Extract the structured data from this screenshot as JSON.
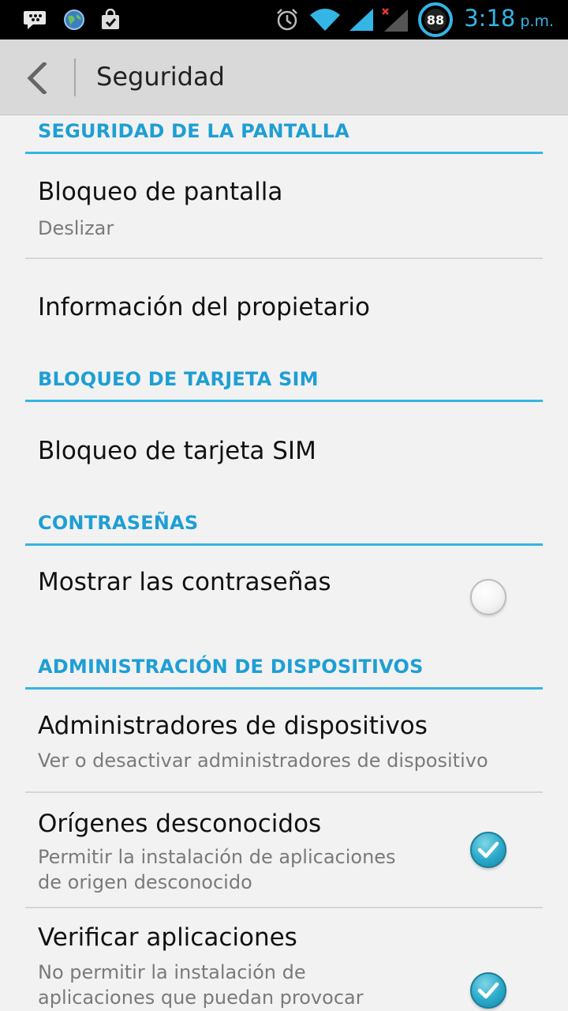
{
  "status_bar": {
    "time": "3:18",
    "ampm": "p.m.",
    "battery_level": "88",
    "icons": [
      "bbm-icon",
      "globe-icon",
      "shopping-bag-icon",
      "alarm-icon",
      "wifi-icon",
      "signal-icon",
      "signal-no-sim-icon",
      "battery-icon"
    ]
  },
  "action_bar": {
    "title": "Seguridad",
    "back_icon": "chevron-left-icon"
  },
  "sections": [
    {
      "header": "SEGURIDAD DE LA PANTALLA",
      "items": [
        {
          "title": "Bloqueo de pantalla",
          "summary": "Deslizar"
        },
        {
          "title": "Información del propietario"
        }
      ]
    },
    {
      "header": "BLOQUEO DE TARJETA SIM",
      "items": [
        {
          "title": "Bloqueo de tarjeta SIM"
        }
      ]
    },
    {
      "header": "CONTRASEÑAS",
      "items": [
        {
          "title": "Mostrar las contraseñas",
          "checked": false
        }
      ]
    },
    {
      "header": "ADMINISTRACIÓN DE DISPOSITIVOS",
      "items": [
        {
          "title": "Administradores de dispositivos",
          "summary": "Ver o desactivar administradores de dispositivo"
        },
        {
          "title": "Orígenes desconocidos",
          "summary_lines": [
            "Permitir la instalación de aplicaciones",
            "de origen desconocido"
          ],
          "checked": true
        },
        {
          "title": "Verificar aplicaciones",
          "summary_lines": [
            "No permitir la instalación de",
            "aplicaciones que puedan provocar"
          ],
          "checked": true
        }
      ]
    }
  ],
  "colors": {
    "accent": "#33b5e5",
    "section_text": "#1e9fd4",
    "action_bar": "#d9d9d9",
    "background": "#f2f2f2",
    "checkbox_on": "#29a9c8"
  }
}
